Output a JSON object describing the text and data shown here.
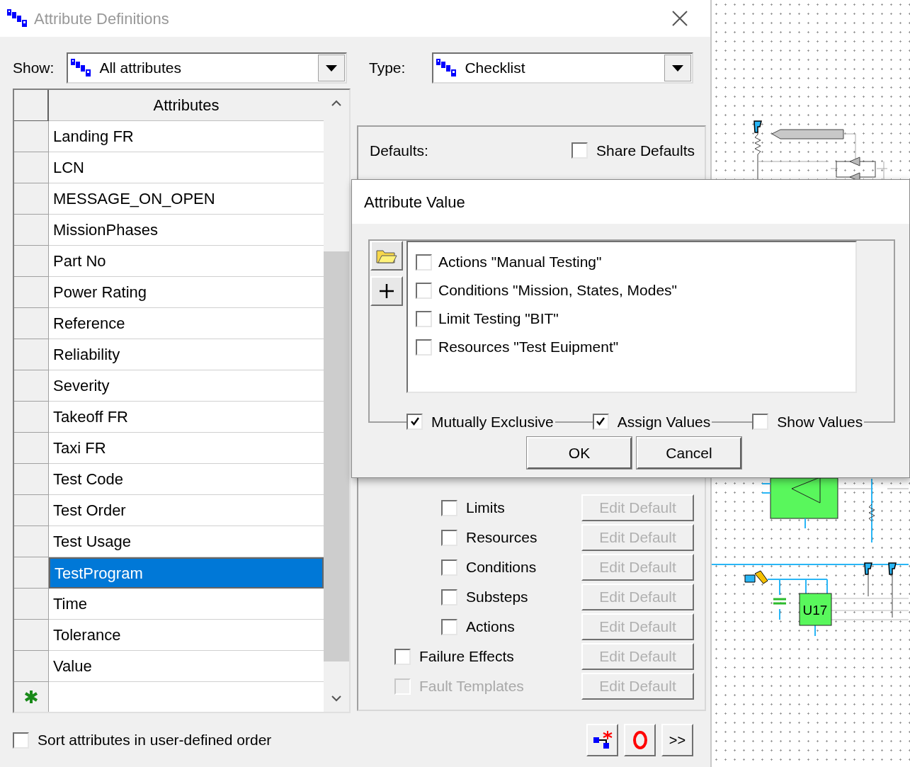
{
  "window": {
    "title": "Attribute Definitions"
  },
  "show": {
    "label": "Show:",
    "value": "All attributes"
  },
  "type": {
    "label": "Type:",
    "value": "Checklist"
  },
  "attributes_table": {
    "column": "Attributes",
    "rows": [
      {
        "name": "Landing FR",
        "selected": false
      },
      {
        "name": "LCN",
        "selected": false
      },
      {
        "name": "MESSAGE_ON_OPEN",
        "selected": false
      },
      {
        "name": "MissionPhases",
        "selected": false
      },
      {
        "name": "Part No",
        "selected": false
      },
      {
        "name": "Power Rating",
        "selected": false
      },
      {
        "name": "Reference",
        "selected": false
      },
      {
        "name": "Reliability",
        "selected": false
      },
      {
        "name": "Severity",
        "selected": false
      },
      {
        "name": "Takeoff FR",
        "selected": false
      },
      {
        "name": "Taxi FR",
        "selected": false
      },
      {
        "name": "Test Code",
        "selected": false
      },
      {
        "name": "Test Order",
        "selected": false
      },
      {
        "name": "Test Usage",
        "selected": false
      },
      {
        "name": "TestProgram",
        "selected": true
      },
      {
        "name": "Time",
        "selected": false
      },
      {
        "name": "Tolerance",
        "selected": false
      },
      {
        "name": "Value",
        "selected": false
      }
    ]
  },
  "defaults": {
    "label": "Defaults:",
    "share_defaults": {
      "label": "Share Defaults",
      "checked": false
    },
    "items": [
      {
        "kind": "subitem",
        "label": "Limits",
        "checked": false,
        "disabled": false,
        "button": {
          "label": "Edit Default",
          "disabled": true
        }
      },
      {
        "kind": "subitem",
        "label": "Resources",
        "checked": false,
        "disabled": false,
        "button": {
          "label": "Edit Default",
          "disabled": true
        }
      },
      {
        "kind": "subitem",
        "label": "Conditions",
        "checked": false,
        "disabled": false,
        "button": {
          "label": "Edit Default",
          "disabled": true
        }
      },
      {
        "kind": "subitem",
        "label": "Substeps",
        "checked": false,
        "disabled": false,
        "button": {
          "label": "Edit Default",
          "disabled": true
        }
      },
      {
        "kind": "subitem",
        "label": "Actions",
        "checked": false,
        "disabled": false,
        "button": {
          "label": "Edit Default",
          "disabled": true
        }
      },
      {
        "kind": "item",
        "label": "Failure Effects",
        "checked": false,
        "disabled": false,
        "button": {
          "label": "Edit Default",
          "disabled": true
        }
      },
      {
        "kind": "item",
        "label": "Fault Templates",
        "checked": false,
        "disabled": true,
        "button": {
          "label": "Edit Default",
          "disabled": true
        }
      }
    ]
  },
  "sort": {
    "label": "Sort attributes in user-defined order",
    "checked": false
  },
  "toolbar": [
    {
      "kind": "icon-add"
    },
    {
      "kind": "icon-ring"
    },
    {
      "kind": "text",
      "label": ">>"
    }
  ],
  "dialog": {
    "title": "Attribute Value",
    "options": [
      {
        "label": "Actions \"Manual Testing\"",
        "checked": false
      },
      {
        "label": "Conditions \"Mission, States, Modes\"",
        "checked": false
      },
      {
        "label": "Limit Testing \"BIT\"",
        "checked": false
      },
      {
        "label": "Resources \"Test Euipment\"",
        "checked": false
      }
    ],
    "flags": [
      {
        "label": "Mutually Exclusive",
        "checked": true
      },
      {
        "label": "Assign Values",
        "checked": true
      },
      {
        "label": "Show Values",
        "checked": false
      }
    ],
    "buttons": [
      "OK",
      "Cancel"
    ]
  },
  "schematic": {
    "part_label": "U17"
  }
}
